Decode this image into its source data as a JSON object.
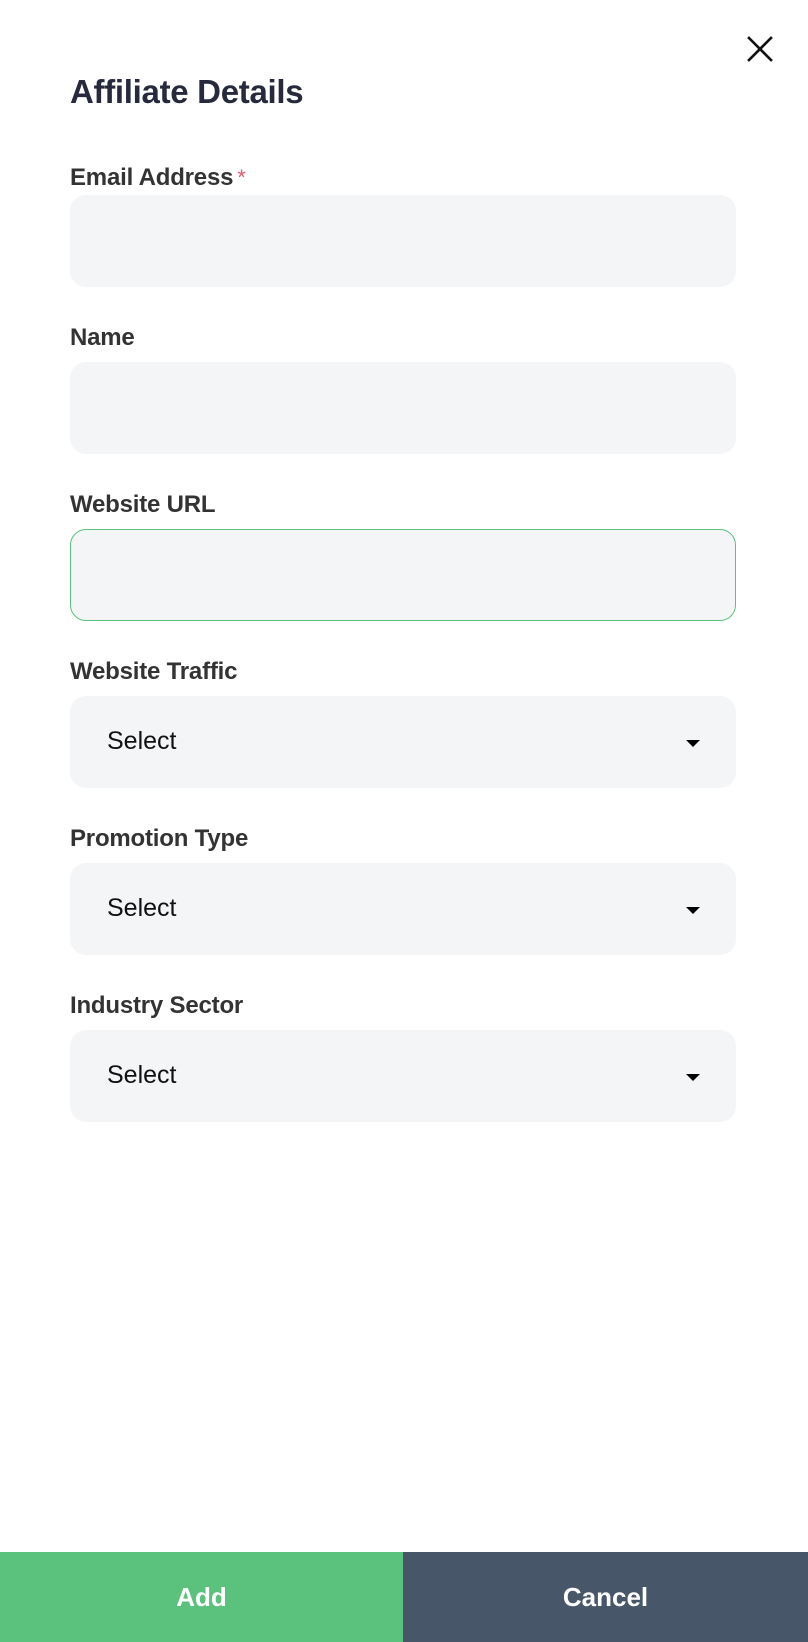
{
  "dialog": {
    "title": "Affiliate Details",
    "close_icon": "close-icon"
  },
  "colors": {
    "primary": "#5bc27d",
    "secondary": "#48566a",
    "required": "#e05a6e",
    "field_bg": "#f4f5f7",
    "title": "#272a3d"
  },
  "fields": {
    "email": {
      "label": "Email Address",
      "required_mark": "*",
      "value": "",
      "placeholder": ""
    },
    "name": {
      "label": "Name",
      "value": "",
      "placeholder": ""
    },
    "website_url": {
      "label": "Website URL",
      "value": "",
      "placeholder": "",
      "state": "focused"
    },
    "website_traffic": {
      "label": "Website Traffic",
      "selected": "Select",
      "icon": "caret-down-icon"
    },
    "promotion_type": {
      "label": "Promotion Type",
      "selected": "Select",
      "icon": "caret-down-icon"
    },
    "industry_sector": {
      "label": "Industry Sector",
      "selected": "Select",
      "icon": "caret-down-icon"
    }
  },
  "footer": {
    "add_label": "Add",
    "cancel_label": "Cancel"
  }
}
